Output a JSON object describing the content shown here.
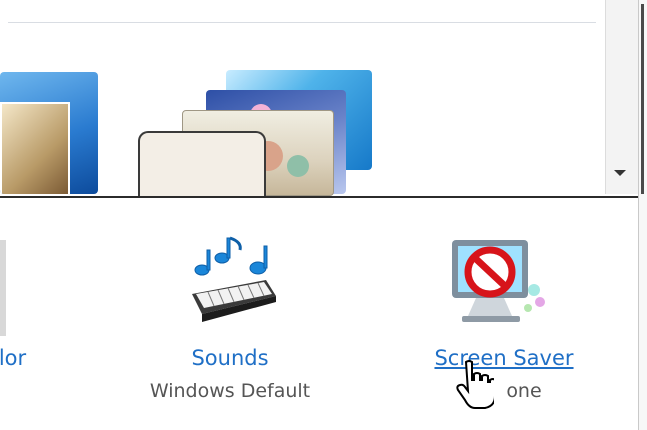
{
  "personalize": {
    "items": [
      {
        "id": "color",
        "label": "olor"
      },
      {
        "id": "sounds",
        "label": "Sounds",
        "value": "Windows Default",
        "icon": "music-keyboard-icon"
      },
      {
        "id": "screen_saver",
        "label": "Screen Saver",
        "value": "one",
        "icon": "no-screensaver-icon"
      }
    ]
  },
  "colors": {
    "link": "#1f6fc6",
    "subtext": "#555555"
  }
}
